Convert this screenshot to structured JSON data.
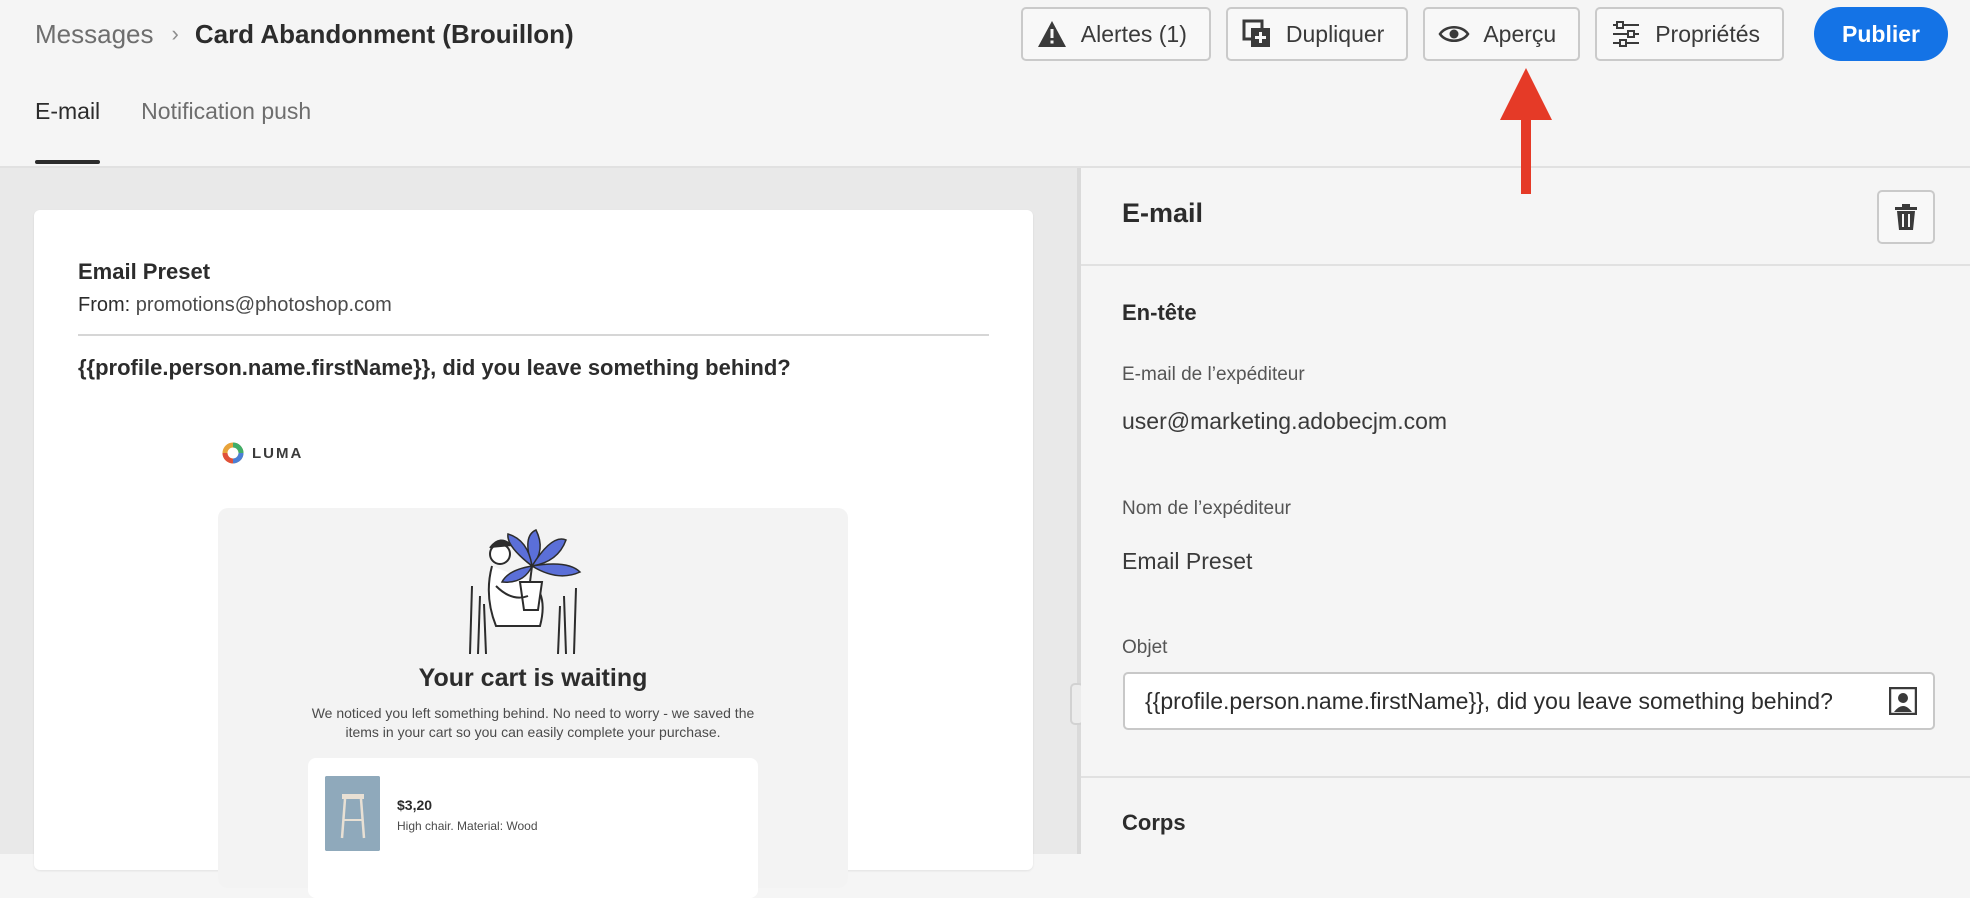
{
  "header": {
    "breadcrumb_parent": "Messages",
    "breadcrumb_separator": "›",
    "breadcrumb_current": "Card Abandonment (Brouillon)",
    "actions": {
      "alerts": "Alertes (1)",
      "duplicate": "Dupliquer",
      "preview": "Aperçu",
      "properties": "Propriétés",
      "publish": "Publier"
    },
    "tabs": [
      {
        "label": "E-mail",
        "active": true
      },
      {
        "label": "Notification push",
        "active": false
      }
    ]
  },
  "preview": {
    "sender_name": "Email Preset",
    "from_label": "From:",
    "from_email": "promotions@photoshop.com",
    "subject": "{{profile.person.name.firstName}}, did you leave something behind?",
    "brand": "LUMA",
    "body_title": "Your cart is waiting",
    "body_text": "We noticed you left something behind. No need to worry - we saved the items in your cart so you can easily complete your purchase.",
    "product_price": "$3,20",
    "product_desc": "High chair. Material: Wood"
  },
  "panel": {
    "title": "E-mail",
    "header_section": "En-tête",
    "sender_email_label": "E-mail de l’expéditeur",
    "sender_email_value": "user@marketing.adobecjm.com",
    "sender_name_label": "Nom de l’expéditeur",
    "sender_name_value": "Email Preset",
    "subject_label": "Objet",
    "subject_value": "{{profile.person.name.firstName}}, did you leave something behind?",
    "body_section": "Corps"
  },
  "colors": {
    "accent": "#1473e6",
    "annotation_arrow": "#e53a27",
    "illustration_leaf": "#5b6fd8"
  }
}
